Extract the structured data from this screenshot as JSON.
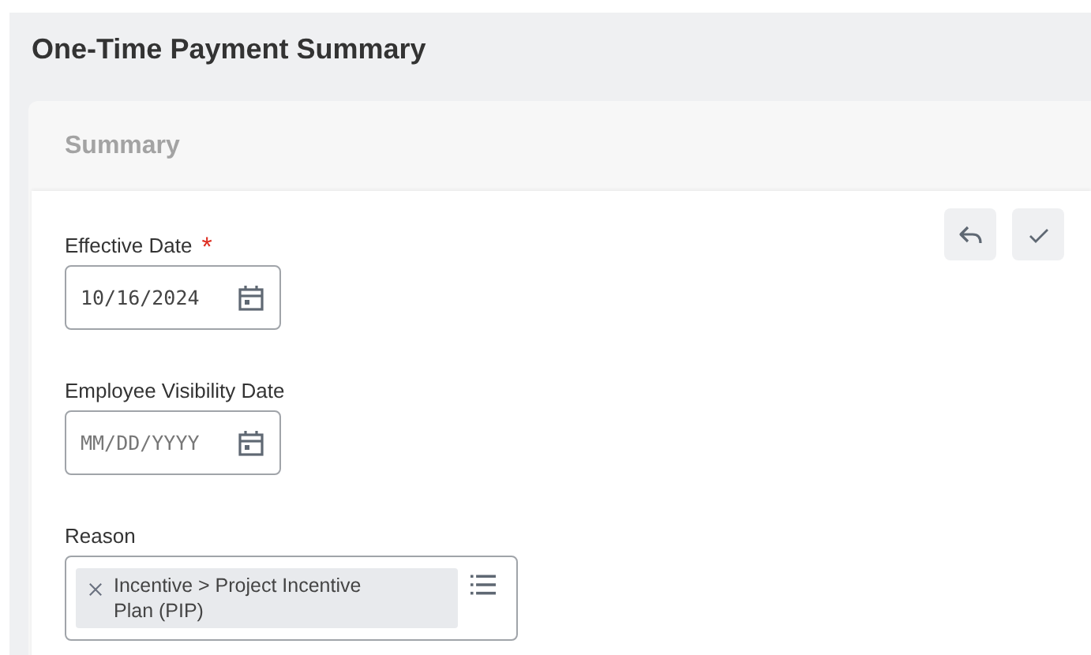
{
  "page_title": "One-Time Payment Summary",
  "section": {
    "title": "Summary"
  },
  "actions": [
    {
      "kind": "undo"
    },
    {
      "kind": "confirm"
    }
  ],
  "fields": [
    {
      "kind": "date",
      "label": "Effective Date",
      "required_mark": "*",
      "value": "10/16/2024"
    },
    {
      "kind": "date",
      "label": "Employee Visibility Date",
      "placeholder": "MM/DD/YYYY"
    },
    {
      "kind": "multiselect",
      "label": "Reason",
      "tags": [
        "Incentive > Project Incentive Plan (PIP)"
      ]
    }
  ]
}
